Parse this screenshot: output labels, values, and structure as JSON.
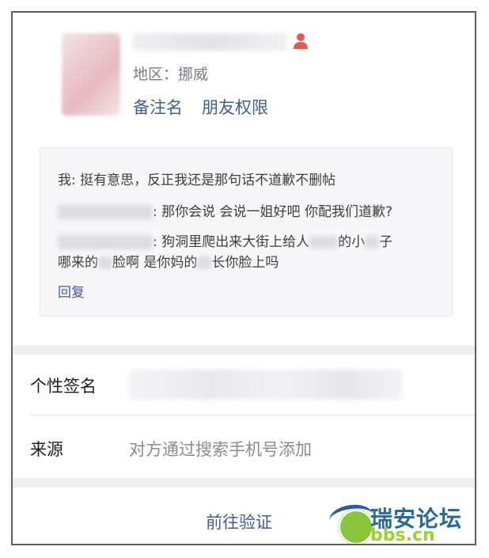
{
  "profile": {
    "region_label": "地区：挪威",
    "actions": [
      "备注名",
      "朋友权限"
    ]
  },
  "moment": {
    "line1": "我: 挺有意思，反正我还是那句话不道歉不删帖",
    "line2_tail": ": 那你会说 会说一姐好吧 你配我们道歉?",
    "line3_tail_a": ": 狗洞里爬出来大街上给人",
    "line3_tail_b": "的小",
    "line3_tail_c": "子",
    "line4_a": "哪来的",
    "line4_b": "脸啊 是你妈的",
    "line4_c": "长你脸上吗",
    "reply": "回复"
  },
  "signature": {
    "label": "个性签名"
  },
  "source": {
    "label": "来源",
    "value": "对方通过搜索手机号添加"
  },
  "bottom": {
    "verify": "前往验证"
  },
  "watermark": {
    "title": "瑞安论坛",
    "sub": "bbs.cn"
  },
  "colors": {
    "link": "#3f5f8c",
    "accent_red": "#e05a5a"
  }
}
